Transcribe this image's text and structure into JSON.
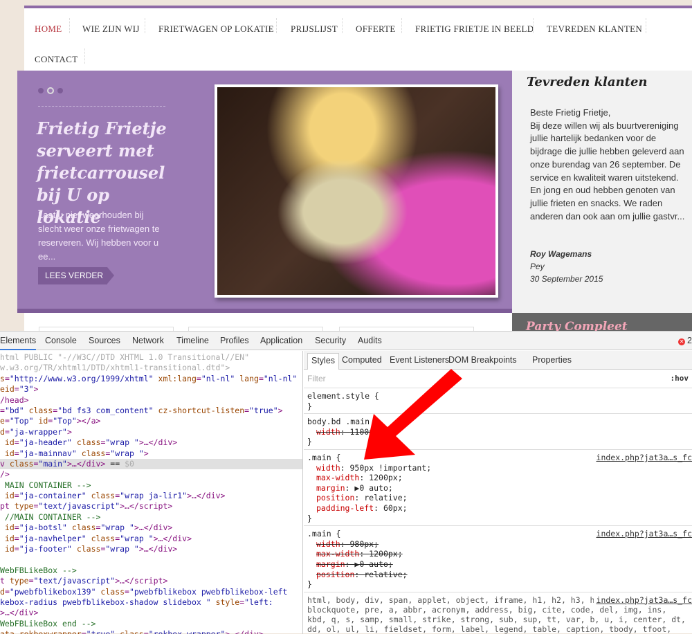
{
  "nav": {
    "items": [
      "HOME",
      "WIE ZIJN WIJ",
      "FRIETWAGEN OP LOKATIE",
      "PRIJSLIJST",
      "OFFERTE",
      "FRIETIG FRIETJE IN BEELD",
      "TEVREDEN KLANTEN",
      "CONTACT"
    ],
    "active": "HOME",
    "active_color": "#b5313a"
  },
  "hero": {
    "title": "Frietig Frietje serveert met frietcarrousel bij U op lokatie",
    "description": "Laat u niet weerhouden bij slecht weer onze frietwagen te reserveren. Wij hebben voor u ee...",
    "button": "LEES VERDER",
    "slides": 3,
    "active_slide": 2,
    "color": "#9b7bb5"
  },
  "sidebar": {
    "title": "Tevreden klanten",
    "text": "Beste Frietig Frietje,\nBij deze willen wij als buurtvereniging jullie hartelijk bedanken voor de bijdrage die jullie hebben geleverd aan onze burendag van 26 september. De service en kwaliteit waren uitstekend. En jong en oud hebben genoten van jullie frieten en snacks. We raden anderen dan ook aan om jullie gastvr...",
    "author": "Roy Wagemans",
    "place": "Pey",
    "date": "30 September 2015",
    "next_title": "Party Compleet"
  },
  "devtools": {
    "tabs": [
      "Elements",
      "Console",
      "Sources",
      "Network",
      "Timeline",
      "Profiles",
      "Application",
      "Security",
      "Audits"
    ],
    "active_tab": "Elements",
    "error_count": "2",
    "dom_lines": [
      [
        [
          "gr",
          "html PUBLIC \"-//W3C//DTD XHTML 1.0 Transitional//EN\""
        ]
      ],
      [
        [
          "gr",
          "w.w3.org/TR/xhtml1/DTD/xhtml1-transitional.dtd\">"
        ]
      ],
      [
        [
          "an",
          "s"
        ],
        [
          "tag",
          "="
        ],
        [
          "av",
          "\"http://www.w3.org/1999/xhtml\""
        ],
        [
          "an",
          " xml:lang"
        ],
        [
          "tag",
          "="
        ],
        [
          "av",
          "\"nl-nl\""
        ],
        [
          "an",
          " lang"
        ],
        [
          "tag",
          "="
        ],
        [
          "av",
          "\"nl-nl\""
        ]
      ],
      [
        [
          "an",
          "eid"
        ],
        [
          "tag",
          "="
        ],
        [
          "av",
          "\"3\""
        ],
        [
          "tag",
          ">"
        ]
      ],
      [
        [
          "tag",
          "/head>"
        ]
      ],
      [
        [
          "tag",
          "="
        ],
        [
          "av",
          "\"bd\""
        ],
        [
          "an",
          " class"
        ],
        [
          "tag",
          "="
        ],
        [
          "av",
          "\"bd fs3 com_content\""
        ],
        [
          "an",
          " cz-shortcut-listen"
        ],
        [
          "tag",
          "="
        ],
        [
          "av",
          "\"true\""
        ],
        [
          "tag",
          ">"
        ]
      ],
      [
        [
          "an",
          "e"
        ],
        [
          "tag",
          "="
        ],
        [
          "av",
          "\"Top\""
        ],
        [
          "an",
          " id"
        ],
        [
          "tag",
          "="
        ],
        [
          "av",
          "\"Top\""
        ],
        [
          "tag",
          "></a>"
        ]
      ],
      [
        [
          "an",
          "d"
        ],
        [
          "tag",
          "="
        ],
        [
          "av",
          "\"ja-wrapper\""
        ],
        [
          "tag",
          ">"
        ]
      ],
      [
        [
          "an",
          " id"
        ],
        [
          "tag",
          "="
        ],
        [
          "av",
          "\"ja-header\""
        ],
        [
          "an",
          " class"
        ],
        [
          "tag",
          "="
        ],
        [
          "av",
          "\"wrap \""
        ],
        [
          "tag",
          ">…</div>"
        ]
      ],
      [
        [
          "an",
          " id"
        ],
        [
          "tag",
          "="
        ],
        [
          "av",
          "\"ja-mainnav\""
        ],
        [
          "an",
          " class"
        ],
        [
          "tag",
          "="
        ],
        [
          "av",
          "\"wrap \""
        ],
        [
          "tag",
          ">"
        ]
      ],
      [
        [
          "tag",
          "v "
        ],
        [
          "an",
          "class"
        ],
        [
          "tag",
          "="
        ],
        [
          "av",
          "\"main\""
        ],
        [
          "tag",
          ">…</div>"
        ],
        [
          "k",
          " == "
        ],
        [
          "gr",
          "$0"
        ]
      ],
      [
        [
          "tag",
          "/>"
        ]
      ],
      [
        [
          "cm",
          " MAIN CONTAINER -->"
        ]
      ],
      [
        [
          "an",
          " id"
        ],
        [
          "tag",
          "="
        ],
        [
          "av",
          "\"ja-container\""
        ],
        [
          "an",
          " class"
        ],
        [
          "tag",
          "="
        ],
        [
          "av",
          "\"wrap ja-lir1\""
        ],
        [
          "tag",
          ">…</div>"
        ]
      ],
      [
        [
          "tag",
          "pt "
        ],
        [
          "an",
          "type"
        ],
        [
          "tag",
          "="
        ],
        [
          "av",
          "\"text/javascript\""
        ],
        [
          "tag",
          ">…</script>"
        ]
      ],
      [
        [
          "cm",
          " //MAIN CONTAINER -->"
        ]
      ],
      [
        [
          "an",
          " id"
        ],
        [
          "tag",
          "="
        ],
        [
          "av",
          "\"ja-botsl\""
        ],
        [
          "an",
          " class"
        ],
        [
          "tag",
          "="
        ],
        [
          "av",
          "\"wrap \""
        ],
        [
          "tag",
          ">…</div>"
        ]
      ],
      [
        [
          "an",
          " id"
        ],
        [
          "tag",
          "="
        ],
        [
          "av",
          "\"ja-navhelper\""
        ],
        [
          "an",
          " class"
        ],
        [
          "tag",
          "="
        ],
        [
          "av",
          "\"wrap \""
        ],
        [
          "tag",
          ">…</div>"
        ]
      ],
      [
        [
          "an",
          " id"
        ],
        [
          "tag",
          "="
        ],
        [
          "av",
          "\"ja-footer\""
        ],
        [
          "an",
          " class"
        ],
        [
          "tag",
          "="
        ],
        [
          "av",
          "\"wrap \""
        ],
        [
          "tag",
          ">…</div>"
        ]
      ],
      [
        [
          "k",
          ""
        ]
      ],
      [
        [
          "cm",
          "WebFBLikeBox -->"
        ]
      ],
      [
        [
          "tag",
          "t "
        ],
        [
          "an",
          "type"
        ],
        [
          "tag",
          "="
        ],
        [
          "av",
          "\"text/javascript\""
        ],
        [
          "tag",
          ">…</script>"
        ]
      ],
      [
        [
          "an",
          "d"
        ],
        [
          "tag",
          "="
        ],
        [
          "av",
          "\"pwebfblikebox139\""
        ],
        [
          "an",
          " class"
        ],
        [
          "tag",
          "="
        ],
        [
          "av",
          "\"pwebfblikebox pwebfblikebox-left"
        ]
      ],
      [
        [
          "av",
          "kebox-radius pwebfblikebox-shadow slidebox \""
        ],
        [
          "an",
          " style"
        ],
        [
          "tag",
          "="
        ],
        [
          "av",
          "\"left:"
        ]
      ],
      [
        [
          "tag",
          ">…</div>"
        ]
      ],
      [
        [
          "cm",
          "WebFBLikeBox end -->"
        ]
      ],
      [
        [
          "an",
          "ata-rokboxwrapper"
        ],
        [
          "tag",
          "="
        ],
        [
          "av",
          "\"true\""
        ],
        [
          "an",
          " class"
        ],
        [
          "tag",
          "="
        ],
        [
          "av",
          "\"rokbox-wrapper\""
        ],
        [
          "tag",
          ">…</div>"
        ]
      ]
    ],
    "selected_line": 10,
    "styles_tabs": [
      "Styles",
      "Computed",
      "Event Listeners",
      "DOM Breakpoints",
      "Properties"
    ],
    "filter_placeholder": "Filter",
    "hov": ":hov",
    "rules": [
      {
        "selector": "element.style {",
        "props": [],
        "source": ""
      },
      {
        "selector": "body.bd .main {",
        "props": [
          {
            "name": "width",
            "value": "1100px",
            "struck": true
          }
        ],
        "source": ""
      },
      {
        "selector": ".main {",
        "props": [
          {
            "name": "width",
            "value": "950px !important",
            "struck": false
          },
          {
            "name": "max-width",
            "value": "1200px",
            "struck": false
          },
          {
            "name": "margin",
            "value": "▶0 auto",
            "struck": false
          },
          {
            "name": "position",
            "value": "relative",
            "struck": false
          },
          {
            "name": "padding-left",
            "value": "60px",
            "struck": false
          }
        ],
        "source": "index.php?jat3a…s_fc"
      },
      {
        "selector": ".main {",
        "props": [
          {
            "name": "width",
            "value": "980px",
            "struck": true
          },
          {
            "name": "max-width",
            "value": "1200px",
            "struck": true
          },
          {
            "name": "margin",
            "value": "▶0 auto",
            "struck": true
          },
          {
            "name": "position",
            "value": "relative",
            "struck": true
          }
        ],
        "source": "index.php?jat3a…s_fc"
      }
    ],
    "ua_rule": {
      "text": "html, body, div, span, applet, object, iframe, h1, h2, h3, h4, h5, h6, p, blockquote, pre, a, abbr, acronym, address, big, cite, code, del, img, ins, kbd, q, s, samp, small, strike, strong, sub, sup, tt, var, b, u, i, center, dt, dd, ol, ul, li, fieldset, form, label, legend, table, caption, tbody, tfoot, th, td, article, aside, canvas, details, embed, figure, figcaption, footer, header",
      "source": "index.php?jat3a…s_fc"
    }
  },
  "annotation": {
    "arrow_color": "#ff0000"
  }
}
